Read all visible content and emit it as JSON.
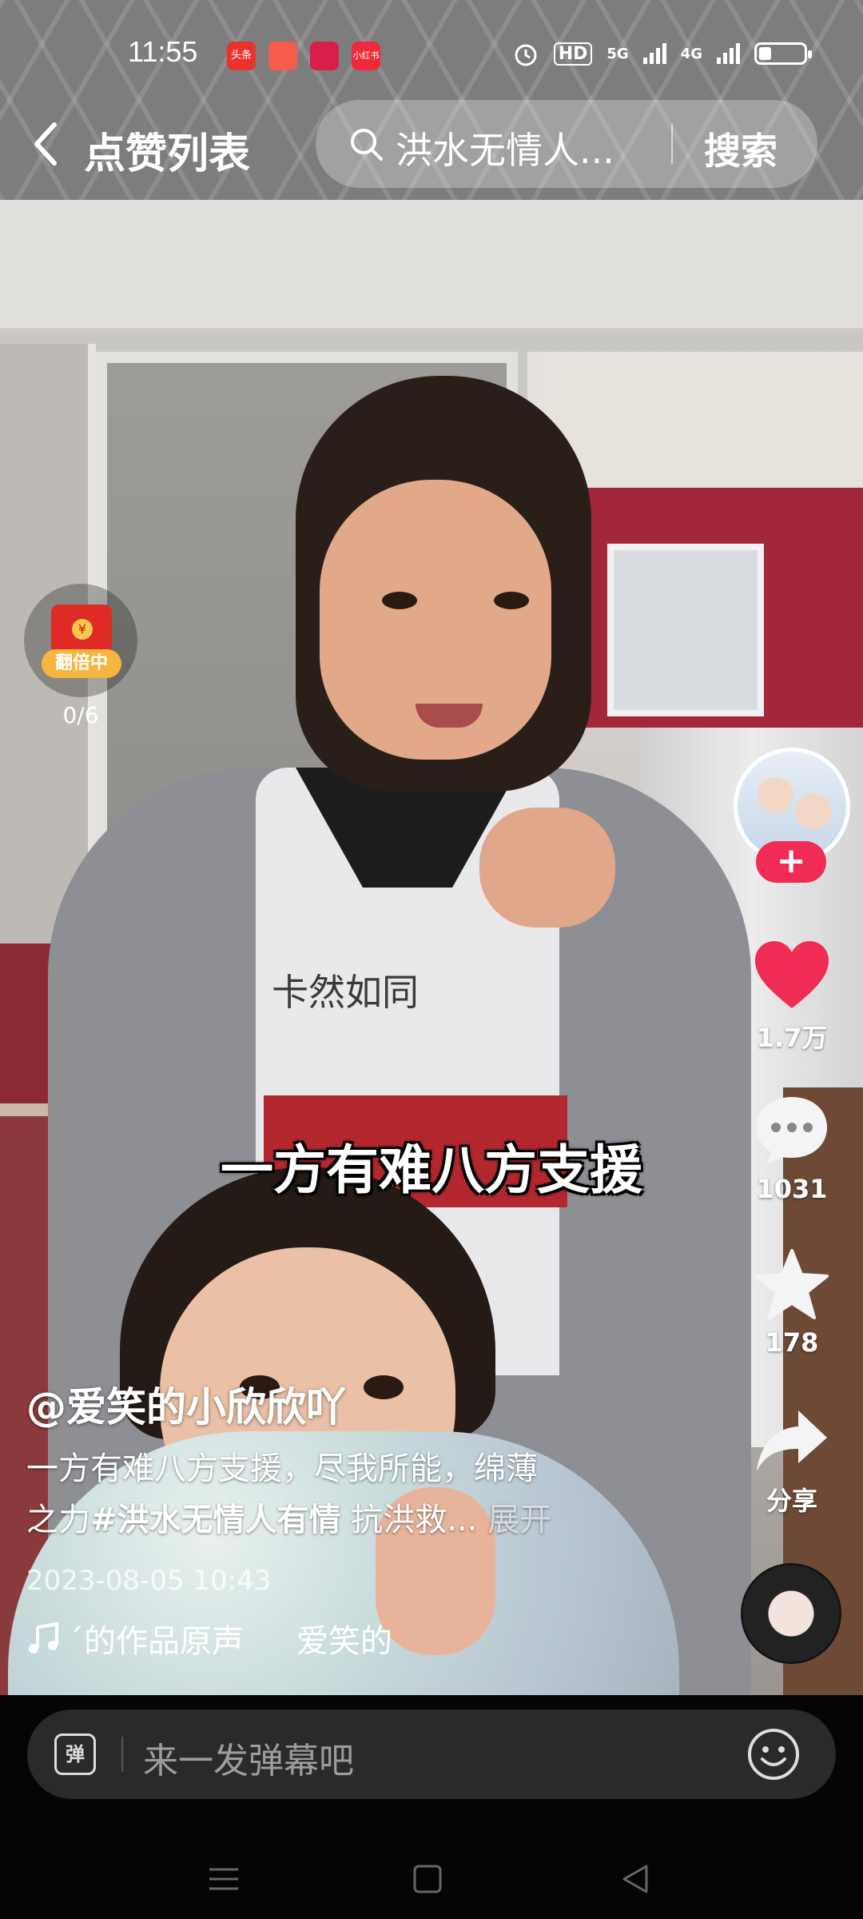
{
  "status_bar": {
    "time": "11:55",
    "app_icons": [
      {
        "label": "头条",
        "color": "#e8322c"
      },
      {
        "label": "",
        "color": "#f65b4b"
      },
      {
        "label": "",
        "color": "#d81f4a"
      },
      {
        "label": "小红书",
        "color": "#ee2a3b"
      }
    ],
    "hd_badge": "HD",
    "net1": "5G",
    "net2": "4G",
    "battery_level": 0.28
  },
  "top_nav": {
    "title": "点赞列表",
    "search_query": "洪水无情人...",
    "search_button": "搜索"
  },
  "red_packet": {
    "badge": "翻倍中",
    "coin": "¥",
    "progress": "0/6"
  },
  "video": {
    "subtitle": "一方有难八方支援",
    "shirt_text": "卡然如同"
  },
  "actions": {
    "follow": "+",
    "likes": "1.7万",
    "comments": "1031",
    "favorites": "178",
    "share": "分享"
  },
  "info": {
    "author": "@爱笑的小欣欣吖",
    "desc_line1": "一方有难八方支援，尽我所能，绵薄",
    "desc_line2_prefix": "之力",
    "hashtag": "#洪水无情人有情",
    "desc_tail": " 抗洪救...",
    "expand": " 展开",
    "date": "2023-08-05 10:43",
    "music_a": "´的作品原声",
    "music_b": "爱笑的"
  },
  "bottom_bar": {
    "danmaku_icon": "弹",
    "danmaku_placeholder": "来一发弹幕吧"
  },
  "colors": {
    "like_red": "#f02c55",
    "follow_red": "#f02c55",
    "packet_gold": "#f6b53e"
  },
  "icons": [
    "back-icon",
    "search-icon",
    "heart-icon",
    "comment-icon",
    "star-icon",
    "share-icon",
    "music-note-icon",
    "emoji-icon",
    "menu-icon",
    "home-icon",
    "back-triangle-icon"
  ]
}
